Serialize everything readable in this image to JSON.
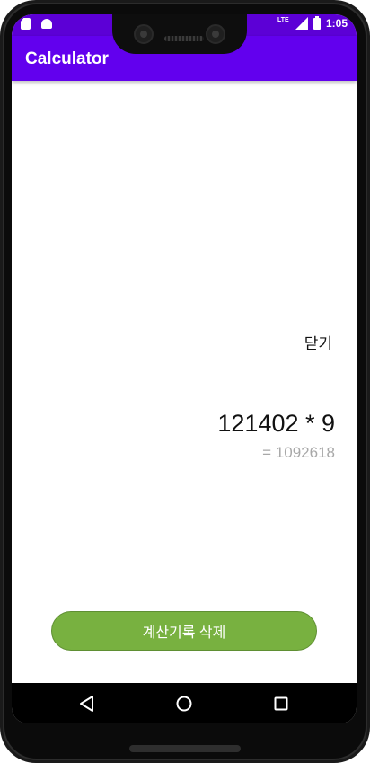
{
  "status_bar": {
    "time": "1:05",
    "network": "LTE",
    "icons": [
      "sim-icon",
      "android-icon",
      "signal-icon",
      "battery-icon"
    ]
  },
  "app_bar": {
    "title": "Calculator"
  },
  "history": {
    "close_label": "닫기",
    "expression": "121402 * 9",
    "result": "= 1092618"
  },
  "clear_history_button": {
    "label": "계산기록 삭제"
  },
  "nav_bar": {
    "icons": [
      "back-icon",
      "home-icon",
      "recents-icon"
    ]
  },
  "colors": {
    "primary": "#6200ee",
    "status_bar": "#5c00d6",
    "button": "#78b140",
    "result_text": "#a8a8a8"
  }
}
